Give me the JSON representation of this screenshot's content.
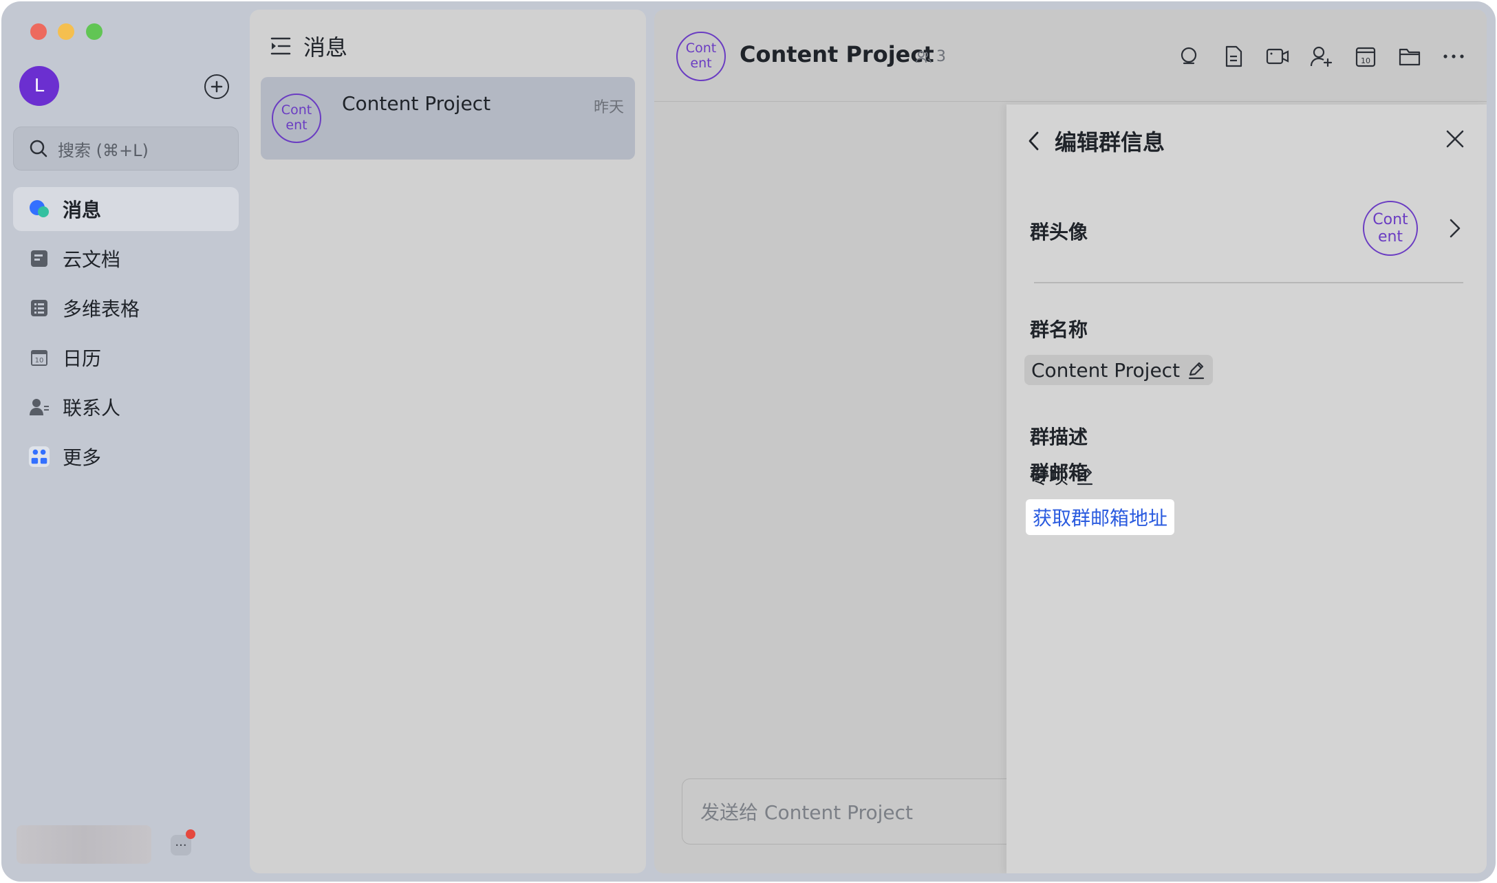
{
  "window": {
    "traffic_lights": [
      "close",
      "minimize",
      "zoom"
    ]
  },
  "sidebar": {
    "user_avatar_letter": "L",
    "search_placeholder": "搜索 (⌘+L)",
    "items": [
      {
        "label": "消息",
        "icon": "message-bubble-icon",
        "active": true
      },
      {
        "label": "云文档",
        "icon": "cloud-doc-icon",
        "active": false
      },
      {
        "label": "多维表格",
        "icon": "base-table-icon",
        "active": false
      },
      {
        "label": "日历",
        "icon": "calendar-icon",
        "active": false
      },
      {
        "label": "联系人",
        "icon": "contacts-icon",
        "active": false
      },
      {
        "label": "更多",
        "icon": "more-apps-icon",
        "active": false
      }
    ],
    "more_button": "···"
  },
  "message_list": {
    "title": "消息",
    "chats": [
      {
        "avatar_line1": "Cont",
        "avatar_line2": "ent",
        "name": "Content Project",
        "time": "昨天"
      }
    ]
  },
  "chat": {
    "avatar_line1": "Cont",
    "avatar_line2": "ent",
    "title": "Content Project",
    "member_count": "3",
    "toolbar_icons": [
      "search-icon",
      "document-icon",
      "video-call-icon",
      "add-member-icon",
      "calendar-icon",
      "folder-icon",
      "more-icon"
    ],
    "composer_placeholder": "发送给 Content Project"
  },
  "edit_group": {
    "title": "编辑群信息",
    "avatar_label": "群头像",
    "avatar_line1": "Cont",
    "avatar_line2": "ent",
    "name_label": "群名称",
    "name_value": "Content Project",
    "desc_label": "群描述",
    "desc_value": "专项",
    "mail_label": "群邮箱",
    "mail_link": "获取群邮箱地址"
  },
  "colors": {
    "accent_purple": "#6a3cc2",
    "link_blue": "#2a5bdf",
    "notification_red": "#e5483e"
  }
}
